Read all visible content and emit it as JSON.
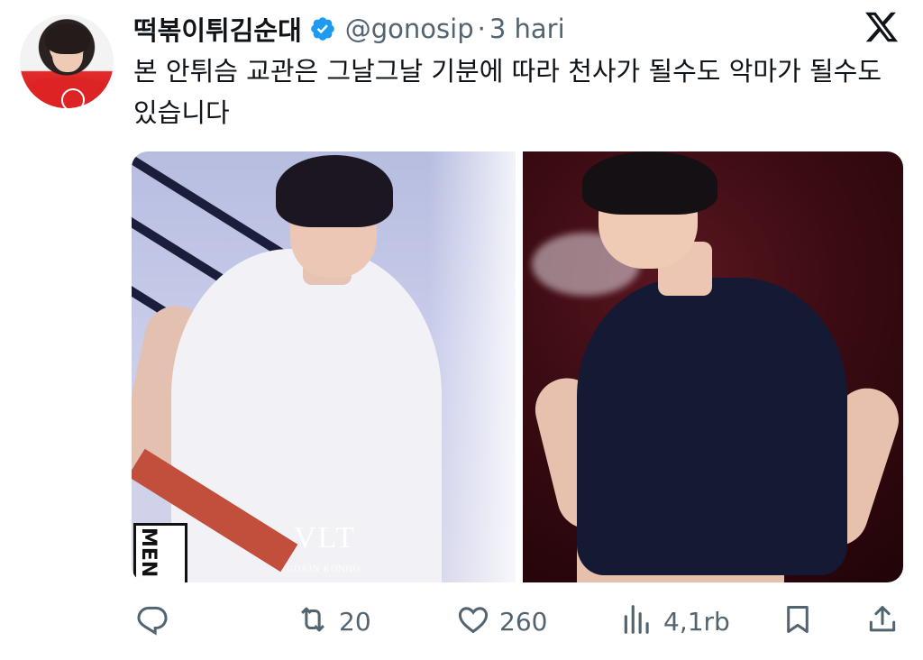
{
  "tweet": {
    "author": {
      "display_name": "떡볶이튀김순대",
      "handle": "@gonosip",
      "verified_icon": "verified-badge-icon",
      "avatar_icon": "profile-avatar"
    },
    "separator": "·",
    "time": "3 hari",
    "platform_icon": "x-logo-icon",
    "text": "본 안튀슴 교관은 그날그날 기분에 따라 천사가 될수도 악마가 될수도 있습니다",
    "media": {
      "left_photo": {
        "tag_text": "MEN",
        "watermark": "VLT",
        "watermark_sub": "GOKIN KONHO"
      },
      "right_photo": {}
    },
    "actions": {
      "reply": {
        "icon": "reply-icon",
        "count": ""
      },
      "retweet": {
        "icon": "retweet-icon",
        "count": "20"
      },
      "like": {
        "icon": "heart-icon",
        "count": "260"
      },
      "views": {
        "icon": "views-icon",
        "count": "4,1rb"
      },
      "bookmark": {
        "icon": "bookmark-icon"
      },
      "share": {
        "icon": "share-icon"
      }
    },
    "colors": {
      "text": "#0f1419",
      "secondary": "#536471",
      "verified": "#1d9bf0"
    }
  }
}
